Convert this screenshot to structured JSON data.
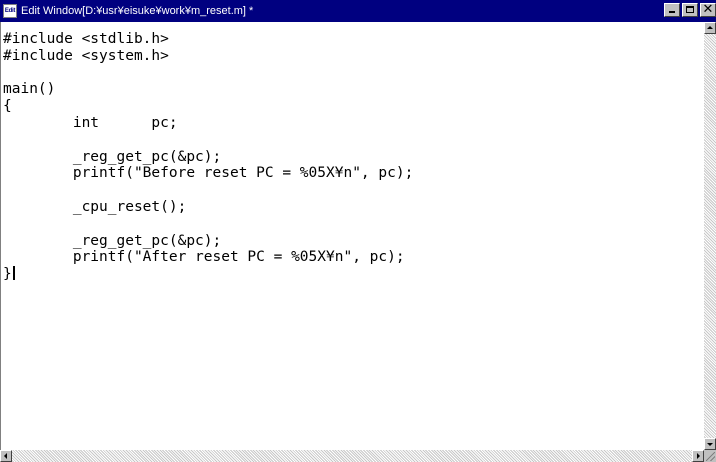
{
  "window": {
    "icon_label": "Edit",
    "title": "Edit Window[D:¥usr¥eisuke¥work¥m_reset.m] *",
    "buttons": [
      "minimize",
      "maximize",
      "close"
    ],
    "close_glyph": "✕"
  },
  "editor": {
    "lines": [
      "#include <stdlib.h>",
      "#include <system.h>",
      "",
      "main()",
      "{",
      "        int      pc;",
      "",
      "        _reg_get_pc(&pc);",
      "        printf(\"Before reset PC = %05X¥n\", pc);",
      "",
      "        _cpu_reset();",
      "",
      "        _reg_get_pc(&pc);",
      "        printf(\"After reset PC = %05X¥n\", pc);",
      "}"
    ]
  },
  "colors": {
    "title_bar": "#000080",
    "title_text": "#ffffff",
    "editor_bg": "#ffffff",
    "chrome": "#c0c0c0"
  }
}
